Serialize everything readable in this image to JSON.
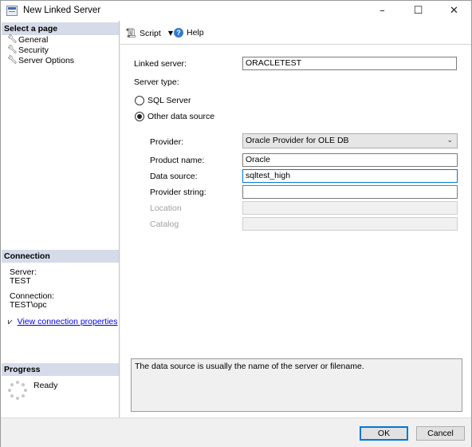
{
  "window": {
    "title": "New Linked Server"
  },
  "sidebar": {
    "select_page_header": "Select a page",
    "pages": [
      {
        "label": "General",
        "icon": "wrench-icon"
      },
      {
        "label": "Security",
        "icon": "wrench-icon"
      },
      {
        "label": "Server Options",
        "icon": "wrench-icon"
      }
    ],
    "connection_header": "Connection",
    "server_label": "Server:",
    "server_value": "TEST",
    "connection_label": "Connection:",
    "connection_value": "TEST\\opc",
    "view_connection_link": "View connection properties",
    "progress_header": "Progress",
    "progress_status": "Ready"
  },
  "toolbar": {
    "script_label": "Script",
    "help_label": "Help"
  },
  "form": {
    "linked_server_label": "Linked server:",
    "linked_server_value": "ORACLETEST",
    "server_type_label": "Server type:",
    "sql_server_option": "SQL Server",
    "other_source_option": "Other data source",
    "provider_label": "Provider:",
    "provider_value": "Oracle Provider for OLE DB",
    "product_name_label": "Product name:",
    "product_name_value": "Oracle",
    "data_source_label": "Data source:",
    "data_source_value": "sqltest_high",
    "provider_string_label": "Provider string:",
    "provider_string_value": "",
    "location_label": "Location",
    "catalog_label": "Catalog",
    "description": "The data source is usually the name of the server or filename."
  },
  "buttons": {
    "ok": "OK",
    "cancel": "Cancel"
  }
}
